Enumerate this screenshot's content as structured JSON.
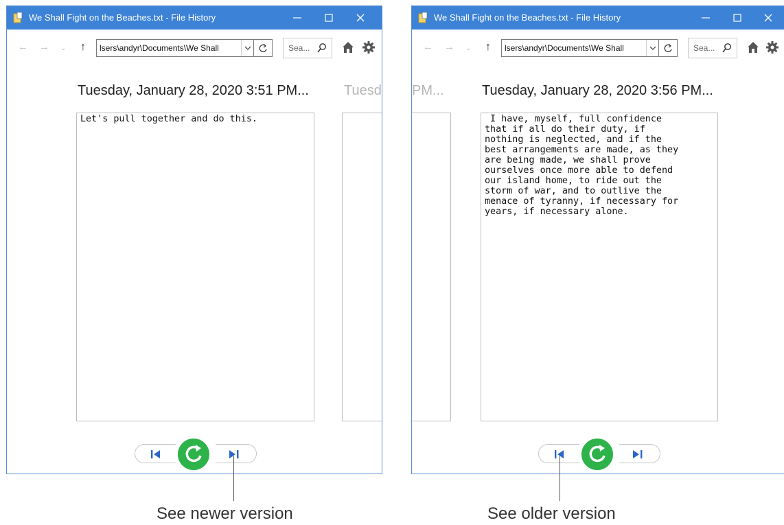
{
  "left_window": {
    "title": "We Shall Fight on the Beaches.txt - File History",
    "address": "lsers\\andyr\\Documents\\We Shall",
    "search_placeholder": "Sea...",
    "date_main": "Tuesday, January 28, 2020 3:51 PM...",
    "date_next_partial": "Tuesd",
    "content": "Let's pull together and do this."
  },
  "right_window": {
    "title": "We Shall Fight on the Beaches.txt - File History",
    "address": "lsers\\andyr\\Documents\\We Shall",
    "search_placeholder": "Sea...",
    "date_prev_partial": "PM...",
    "date_main": "Tuesday, January 28, 2020 3:56 PM...",
    "content": " I have, myself, full confidence\nthat if all do their duty, if\nnothing is neglected, and if the\nbest arrangements are made, as they\nare being made, we shall prove\nourselves once more able to defend\nour island home, to ride out the\nstorm of war, and to outlive the\nmenace of tyranny, if necessary for\nyears, if necessary alone."
  },
  "annotations": {
    "newer": "See newer version",
    "older": "See older version"
  },
  "colors": {
    "titlebar": "#3c82d6",
    "restore_button": "#2db34a",
    "nav_icon": "#2b66c8"
  }
}
